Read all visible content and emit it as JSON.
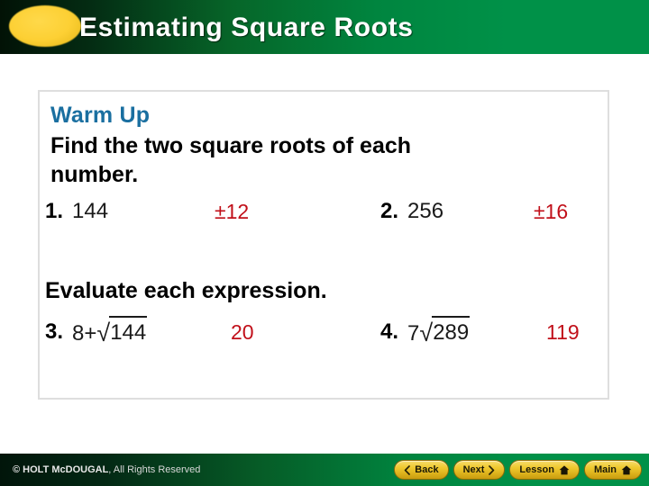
{
  "header": {
    "title": "Estimating Square Roots",
    "bullet_icon": "ellipse-icon"
  },
  "content": {
    "section_title": "Warm Up",
    "instruction_line1": "Find the two square roots of each",
    "instruction_line2": "number.",
    "instruction_b": "Evaluate each expression.",
    "problems": [
      {
        "number": "1.",
        "expression_plain": "144",
        "expr_prefix": "",
        "radicand": "",
        "has_radical": false,
        "answer": "±12"
      },
      {
        "number": "2.",
        "expression_plain": "256",
        "expr_prefix": "",
        "radicand": "",
        "has_radical": false,
        "answer": "±16"
      },
      {
        "number": "3.",
        "expression_plain": "",
        "expr_prefix": "8+",
        "radical_sign": "√",
        "radicand": "144",
        "has_radical": true,
        "answer": "20"
      },
      {
        "number": "4.",
        "expression_plain": "",
        "expr_prefix": "7",
        "radical_sign": "√",
        "radicand": "289",
        "has_radical": true,
        "answer": "119"
      }
    ]
  },
  "footer": {
    "copyright_bold": "© HOLT McDOUGAL",
    "copyright_rest": ", All Rights Reserved",
    "nav": [
      {
        "label": "Back",
        "icon": "chevron-left-icon"
      },
      {
        "label": "Next",
        "icon": "chevron-right-icon"
      },
      {
        "label": "Lesson",
        "icon": "home-icon"
      },
      {
        "label": "Main",
        "icon": "home-icon"
      }
    ]
  },
  "colors": {
    "header_green_light": "#009148",
    "header_green_dark": "#021206",
    "bullet_yellow": "#fdd034",
    "warmup_blue": "#1a6fa0",
    "answer_red": "#c1101a",
    "box_border": "#dedede",
    "nav_gold": "#efc92f"
  }
}
